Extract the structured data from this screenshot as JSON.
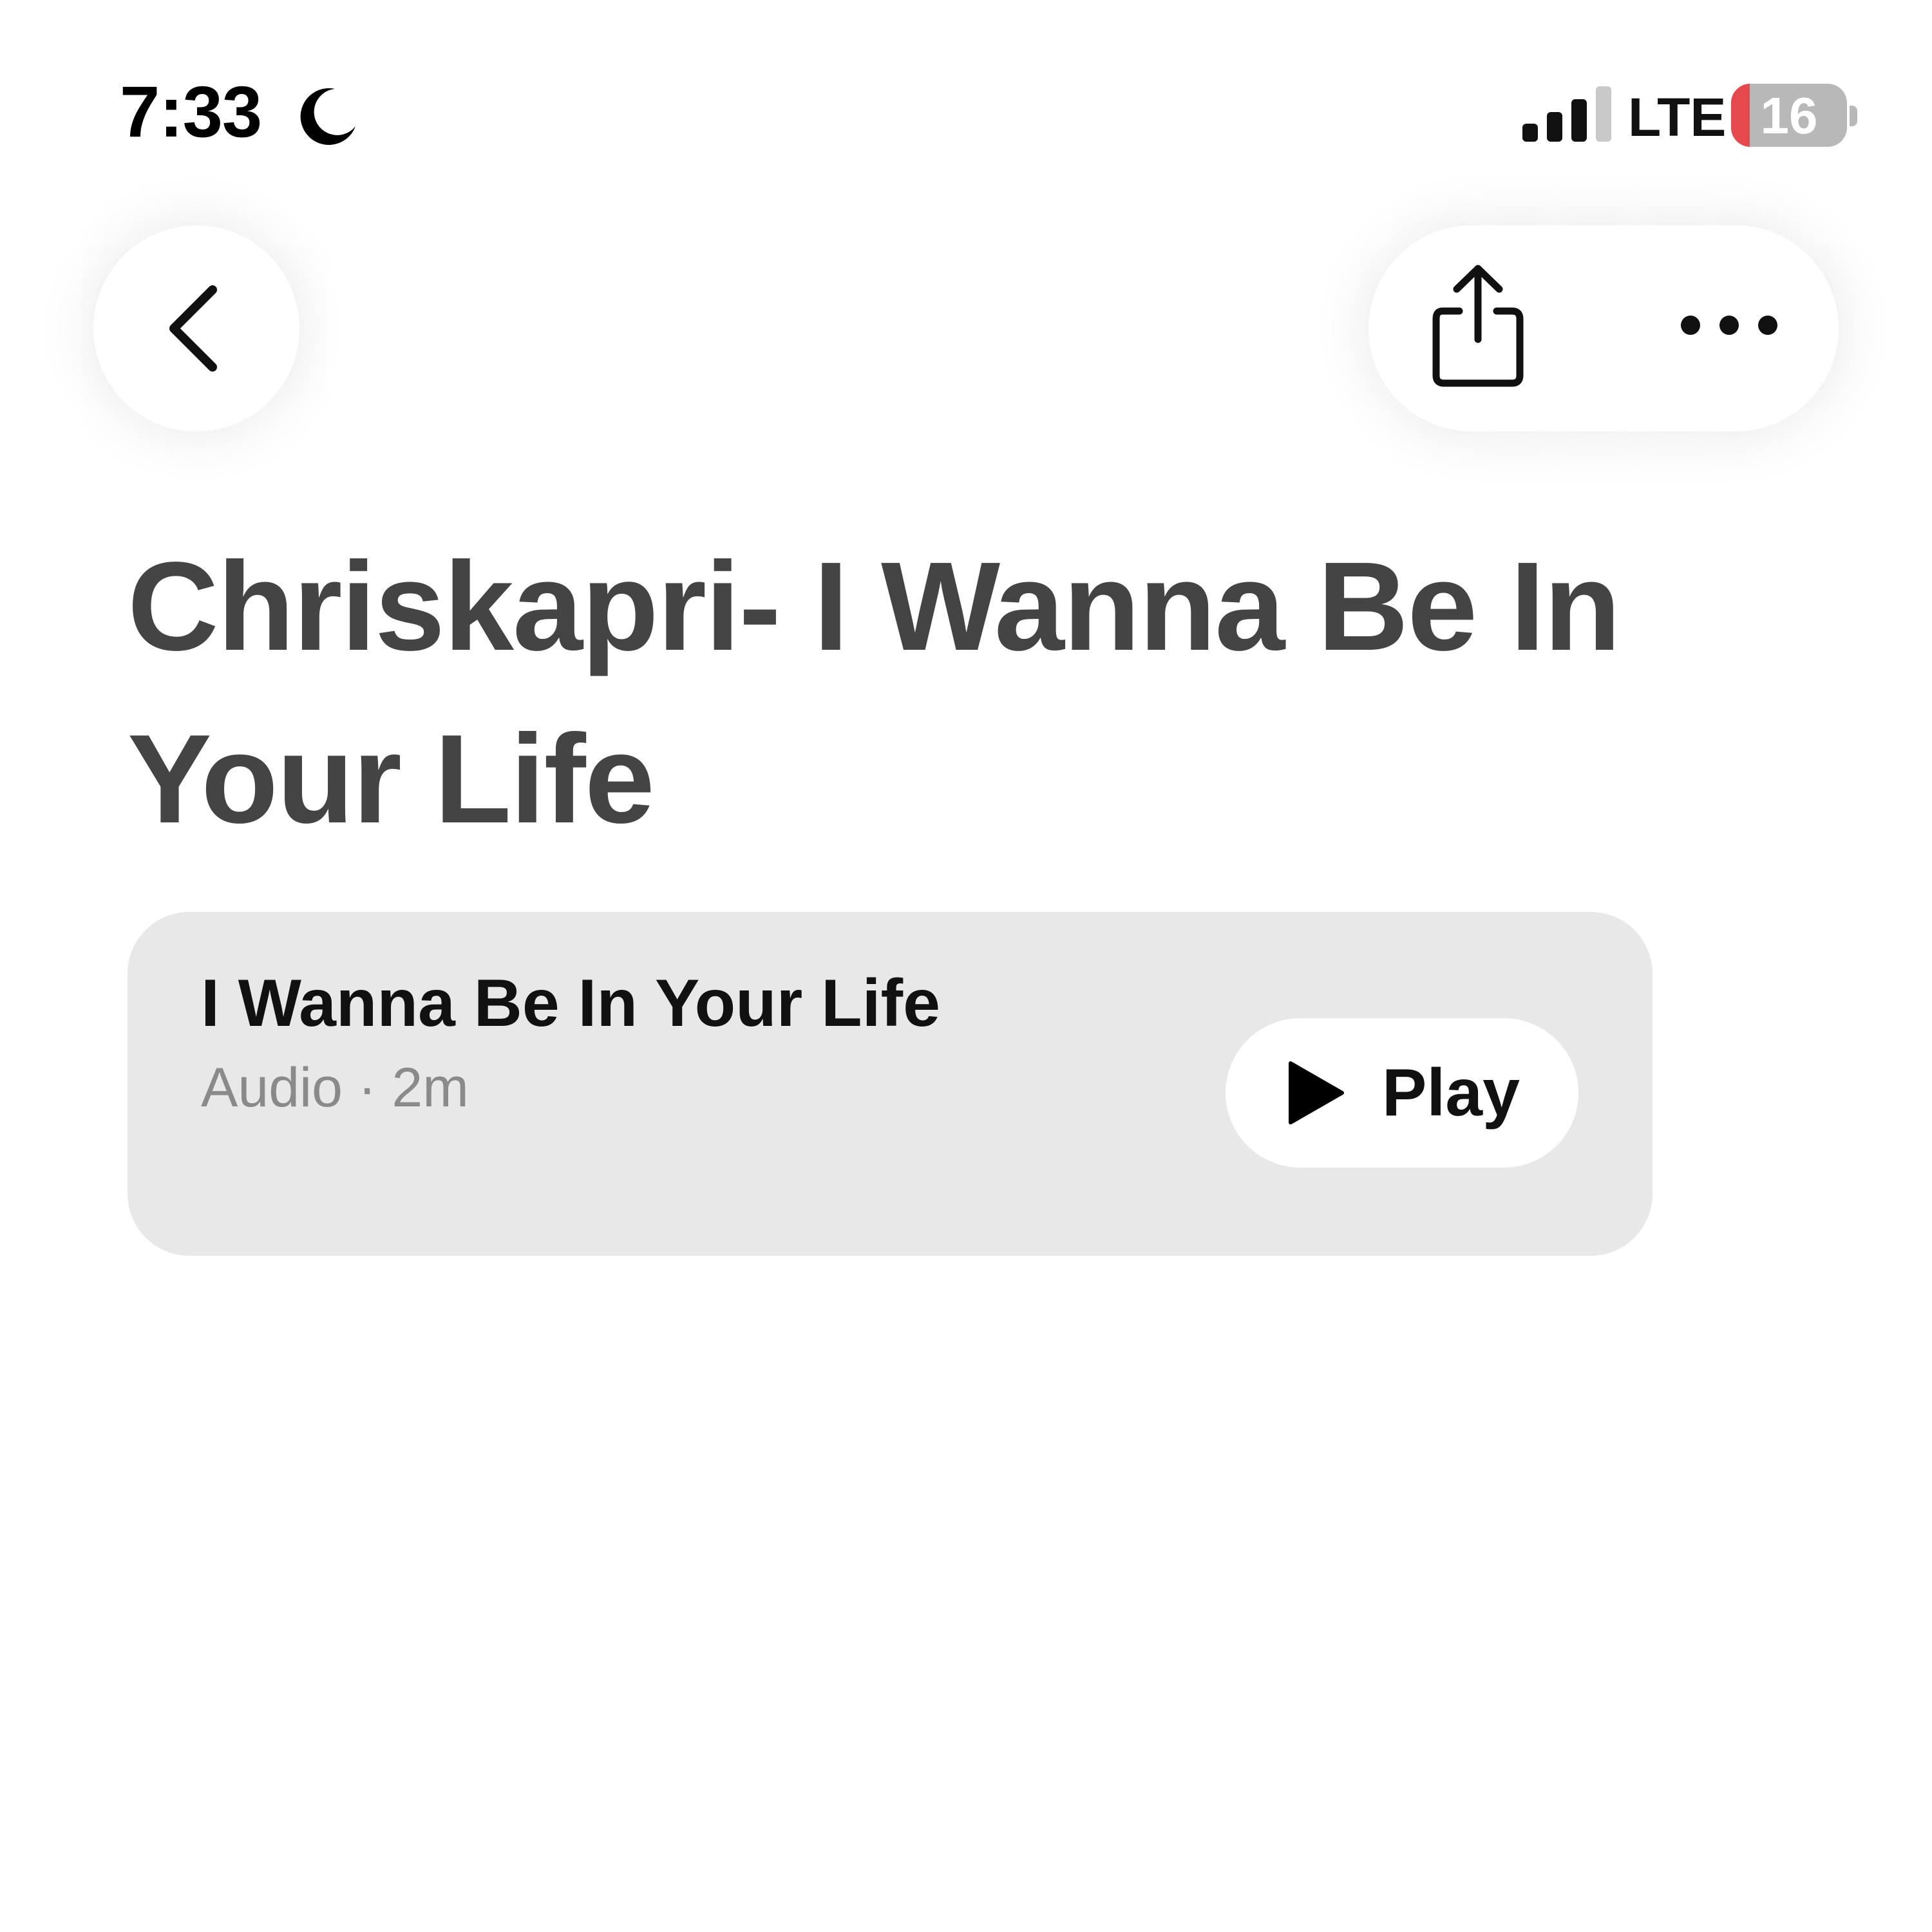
{
  "status_bar": {
    "time": "7:33",
    "focus_icon": "moon-icon",
    "signal_icon": "cellular-signal-icon",
    "network": "LTE",
    "battery_percent": 16,
    "battery_label": "16",
    "battery_low_color": "#e5484d"
  },
  "nav": {
    "back_icon": "chevron-left-icon",
    "share_icon": "share-icon",
    "more_icon": "ellipsis-icon"
  },
  "page": {
    "title": "Chriskapri- I Wanna Be In Your Life",
    "title_color": "#444444"
  },
  "audio_item": {
    "title": "I Wanna Be In Your Life",
    "meta": "Audio · 2m",
    "play_label": "Play",
    "play_icon": "play-icon",
    "card_color": "#e8e8e8"
  }
}
